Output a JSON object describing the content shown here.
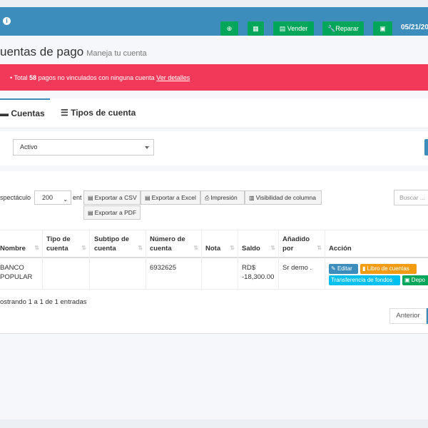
{
  "topbar": {
    "add_icon": "plus-circle-icon",
    "calc_icon": "calculator-icon",
    "sell_label": "Vender",
    "repair_label": "Reparar",
    "cash_icon": "money-icon",
    "date": "05/21/20"
  },
  "page": {
    "title": "uentas de pago",
    "subtitle": "Maneja tu cuenta"
  },
  "alert": {
    "prefix": "Total",
    "count": "58",
    "text": "pagos no vinculados con ninguna cuenta",
    "link": "Ver detalles"
  },
  "tabs": [
    {
      "label": "Cuentas",
      "active": true
    },
    {
      "label": "Tipos de cuenta",
      "active": false
    }
  ],
  "filter": {
    "status_value": "Activo"
  },
  "table_controls": {
    "show_label": "spectáculo",
    "entries_value": "200",
    "entries_suffix": "ent",
    "export_csv": "Exportar a CSV",
    "export_excel": "Exportar a Excel",
    "print": "Impresión",
    "column_visibility": "Visibilidad de columna",
    "export_pdf": "Exportar a PDF",
    "search_placeholder": "Buscar ..."
  },
  "columns": [
    "Nombre",
    "Tipo de cuenta",
    "Subtipo de cuenta",
    "Número de cuenta",
    "Nota",
    "Saldo",
    "Añadido por",
    "Acción"
  ],
  "rows": [
    {
      "name": "BANCO POPULAR",
      "type": "",
      "subtype": "",
      "number": "6932625",
      "note": "",
      "balance": "RD$ -18,300.00",
      "added_by": "Sr demo .",
      "actions": {
        "edit": "Editar",
        "ledger": "Libro de cuentas",
        "transfer": "Transferencia de fondos",
        "deposit": "Depo"
      }
    }
  ],
  "footer": {
    "info": "ostrando 1 a 1 de 1 entradas",
    "prev": "Anterior"
  },
  "colors": {
    "header": "#3c8dbc",
    "alert": "#f2395a",
    "success": "#00a65a"
  }
}
